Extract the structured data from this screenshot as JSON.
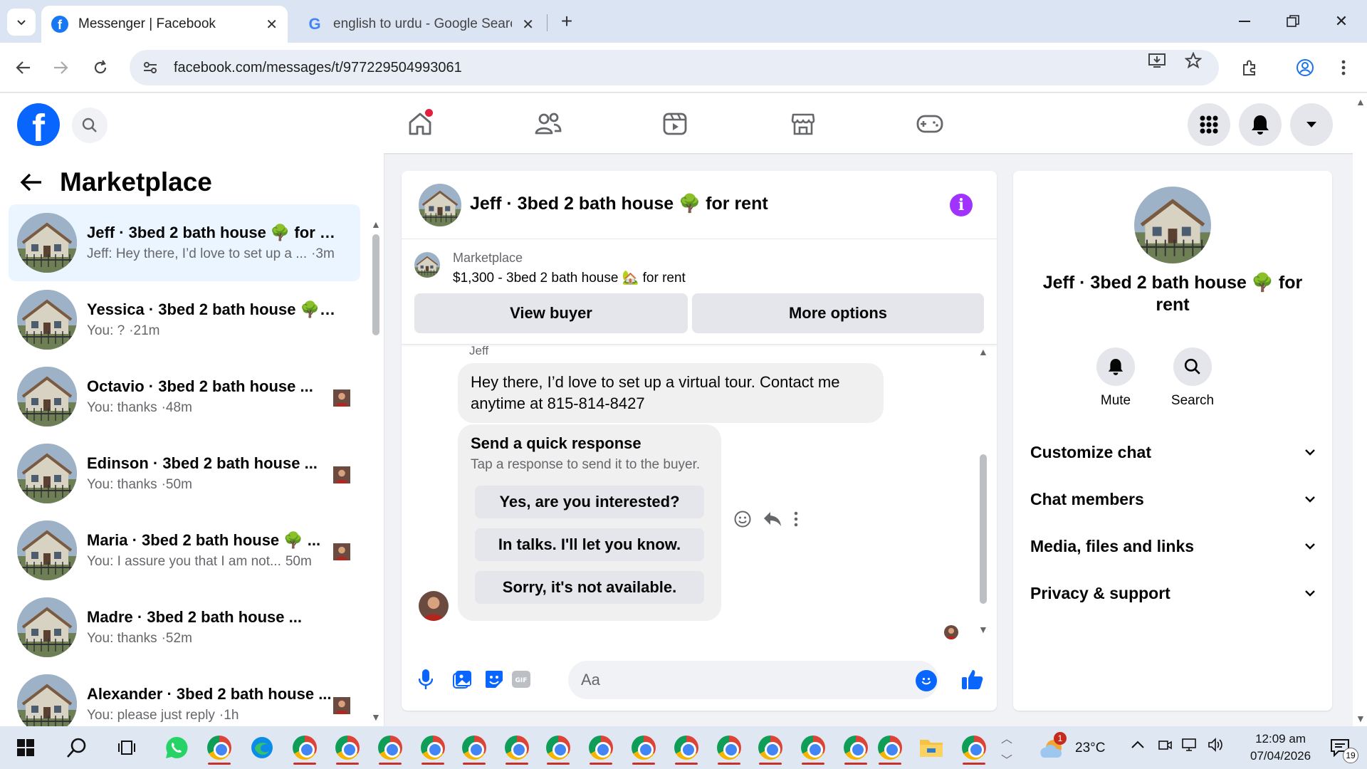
{
  "browser": {
    "tabs": [
      {
        "title": "Messenger | Facebook",
        "favicon": "facebook-favicon",
        "active": true
      },
      {
        "title": "english to urdu - Google Search",
        "favicon": "google-favicon",
        "active": false
      }
    ],
    "url": "facebook.com/messages/t/977229504993061",
    "accent": "#dbe4f3"
  },
  "facebook": {
    "logo_letter": "f",
    "nav_icons": [
      "home-icon",
      "friends-icon",
      "watch-icon",
      "marketplace-icon",
      "gaming-icon"
    ],
    "brand_color": "#0866ff"
  },
  "conversations": {
    "title": "Marketplace",
    "items": [
      {
        "name": "Jeff · 3bed 2 bath house 🌳 for r...",
        "preview": "Jeff: Hey there, I’d love to set up a ...",
        "time": "·3m"
      },
      {
        "name": "Yessica · 3bed 2 bath house 🌳 f...",
        "preview": "You: ?",
        "time": "·21m"
      },
      {
        "name": "Octavio · 3bed 2 bath house ...",
        "preview": "You: thanks",
        "time": "·48m"
      },
      {
        "name": "Edinson · 3bed 2 bath house ...",
        "preview": "You: thanks",
        "time": "·50m"
      },
      {
        "name": "Maria · 3bed 2 bath house 🌳 ...",
        "preview": "You: I assure you that I am not...",
        "time": "50m"
      },
      {
        "name": "Madre · 3bed 2 bath house ...",
        "preview": "You: thanks",
        "time": "·52m"
      },
      {
        "name": "Alexander · 3bed 2 bath house ...",
        "preview": "You: please just reply",
        "time": "·1h"
      }
    ]
  },
  "chat": {
    "title": "Jeff · 3bed 2 bath house 🌳 for rent",
    "info_glyph": "i",
    "marketplace_card": {
      "source": "Marketplace",
      "listing": "$1,300 - 3bed 2 bath house 🏡 for rent",
      "view_buyer": "View buyer",
      "more_options": "More options"
    },
    "sender": "Jeff",
    "message": "Hey there, I’d love to set up a virtual tour. Contact me anytime at 815-814-8427",
    "quick_response": {
      "title": "Send a quick response",
      "subtitle": "Tap a response to send it to the buyer.",
      "options": [
        "Yes, are you interested?",
        "In talks. I'll let you know.",
        "Sorry, it's not available."
      ]
    },
    "composer_placeholder": "Aa"
  },
  "info_panel": {
    "name": "Jeff · 3bed 2 bath house 🌳 for rent",
    "actions": [
      {
        "label": "Mute",
        "icon": "bell-icon"
      },
      {
        "label": "Search",
        "icon": "search-icon"
      }
    ],
    "sections": [
      "Customize chat",
      "Chat members",
      "Media, files and links",
      "Privacy & support"
    ]
  },
  "taskbar": {
    "weather": "23°C",
    "weather_badge": "1",
    "time": "12:09 am",
    "date": "07/04/2026",
    "notifications": "19"
  }
}
